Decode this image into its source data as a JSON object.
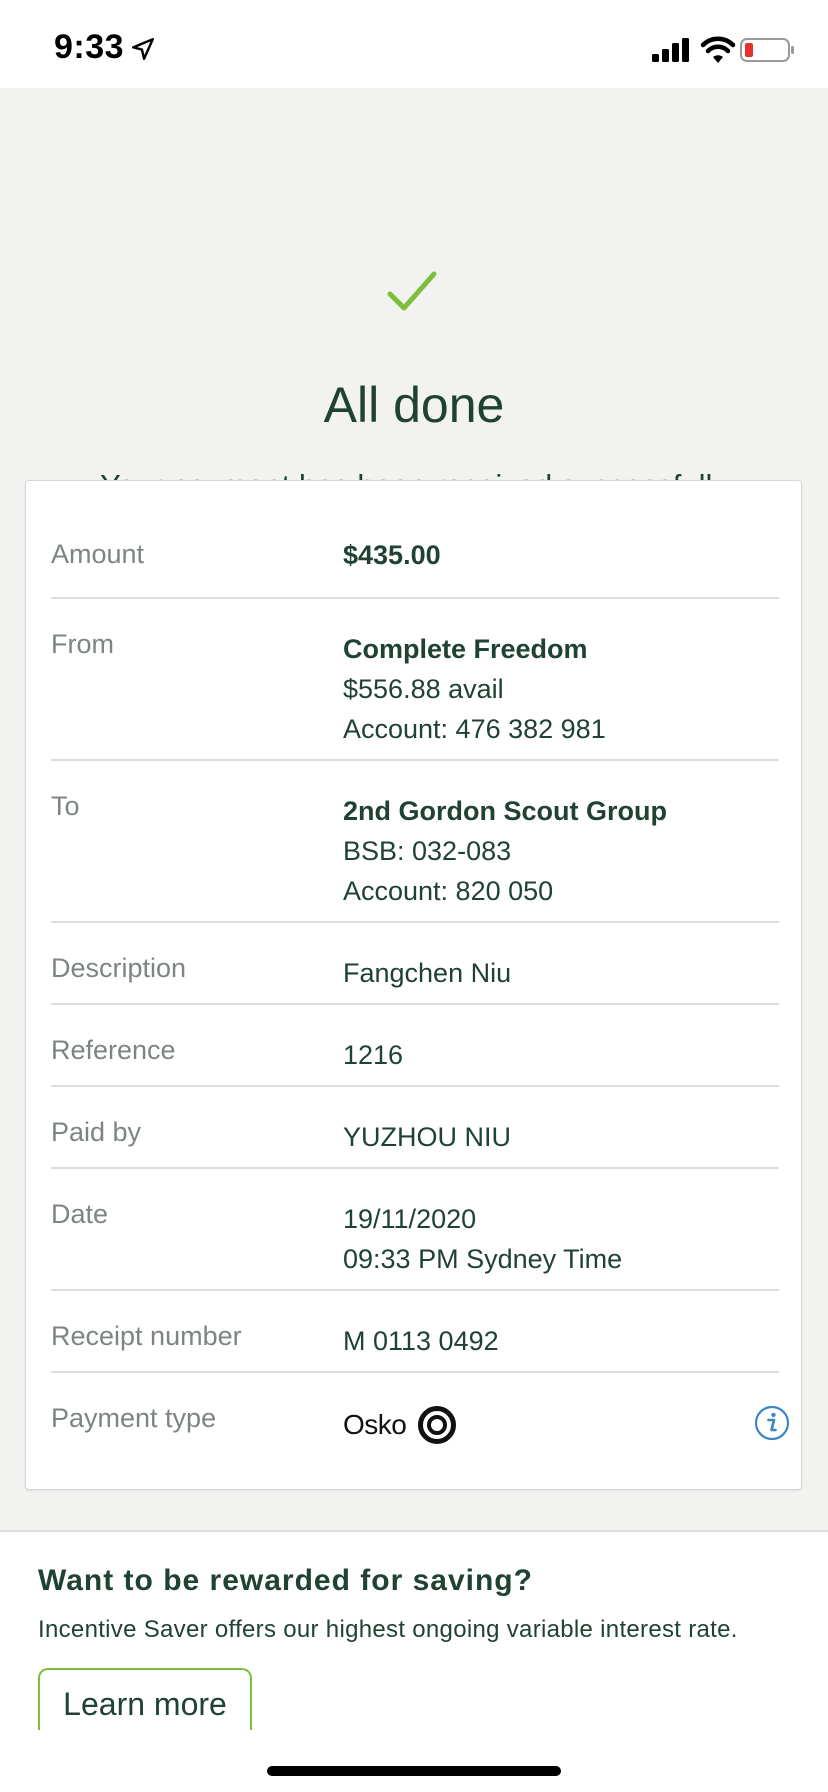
{
  "status_bar": {
    "time": "9:33"
  },
  "confirmation": {
    "title": "All done",
    "subtitle": "Your payment has been received successfully"
  },
  "details": {
    "amount": {
      "label": "Amount",
      "value": "$435.00"
    },
    "from": {
      "label": "From",
      "account_name": "Complete Freedom",
      "available": "$556.88 avail",
      "account": "Account: 476 382 981"
    },
    "to": {
      "label": "To",
      "payee": "2nd Gordon Scout Group",
      "bsb": "BSB: 032-083",
      "account": "Account: 820 050"
    },
    "description": {
      "label": "Description",
      "value": "Fangchen Niu"
    },
    "reference": {
      "label": "Reference",
      "value": "1216"
    },
    "paid_by": {
      "label": "Paid by",
      "value": "YUZHOU NIU"
    },
    "date": {
      "label": "Date",
      "date": "19/11/2020",
      "time": "09:33 PM Sydney Time"
    },
    "receipt": {
      "label": "Receipt number",
      "value": "M 0113 0492"
    },
    "payment_type": {
      "label": "Payment type",
      "value": "Osko",
      "icon": "info-icon"
    }
  },
  "promo": {
    "title": "Want to be rewarded for saving?",
    "text": "Incentive Saver offers our highest ongoing variable interest rate.",
    "button_label": "Learn more"
  },
  "colors": {
    "primary_text": "#1f4232",
    "label_text": "#7d8580",
    "accent_green": "#7cbf3c",
    "info_blue": "#3a86c8",
    "background": "#f2f2f0"
  }
}
